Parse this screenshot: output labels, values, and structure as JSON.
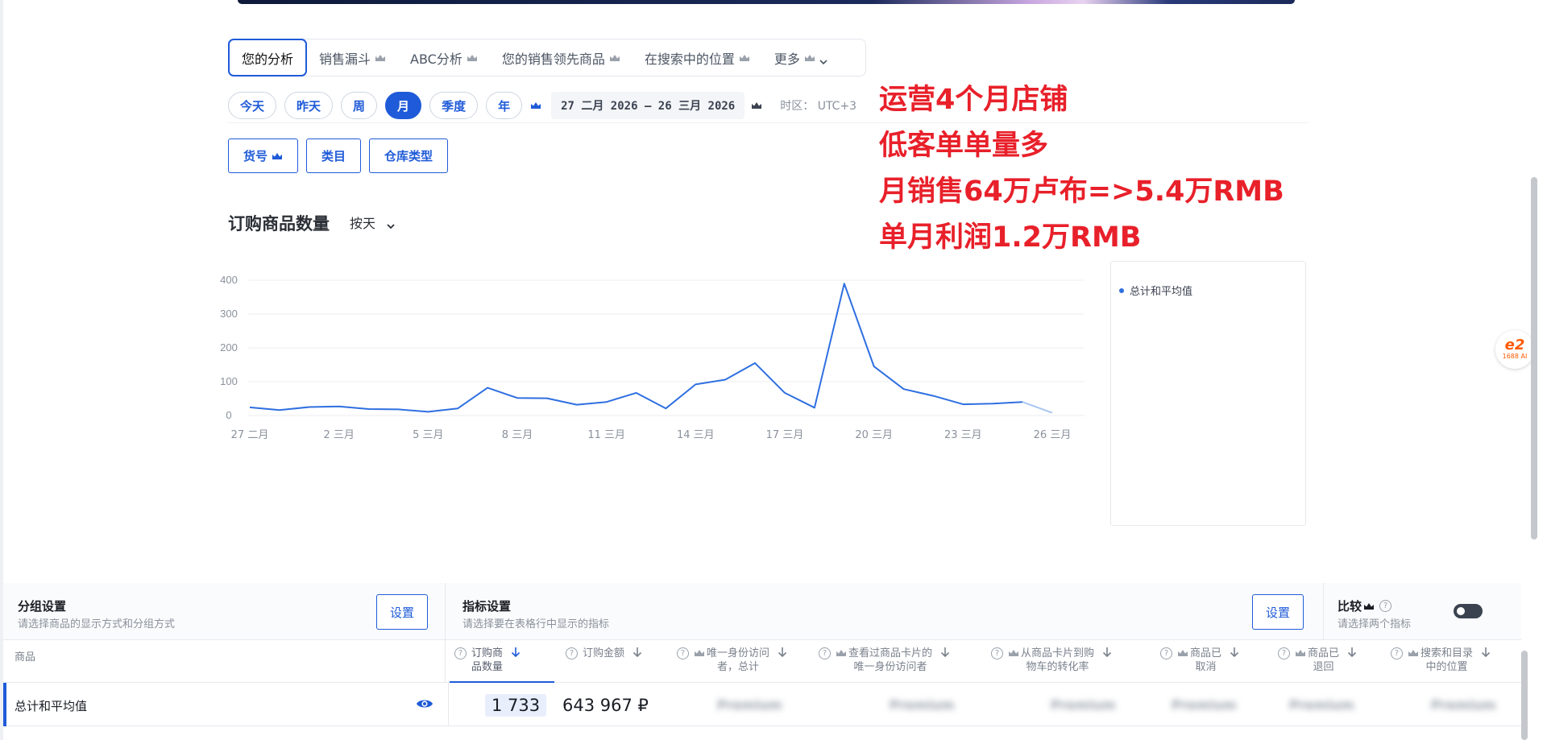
{
  "tabs": [
    {
      "label": "您的分析",
      "active": true,
      "crown": false,
      "chevron": false
    },
    {
      "label": "销售漏斗",
      "active": false,
      "crown": true,
      "chevron": false
    },
    {
      "label": "ABC分析",
      "active": false,
      "crown": true,
      "chevron": false
    },
    {
      "label": "您的销售领先商品",
      "active": false,
      "crown": true,
      "chevron": false
    },
    {
      "label": "在搜索中的位置",
      "active": false,
      "crown": true,
      "chevron": false
    },
    {
      "label": "更多",
      "active": false,
      "crown": true,
      "chevron": true
    }
  ],
  "periods": [
    {
      "label": "今天",
      "active": false
    },
    {
      "label": "昨天",
      "active": false
    },
    {
      "label": "周",
      "active": false
    },
    {
      "label": "月",
      "active": true
    },
    {
      "label": "季度",
      "active": false
    },
    {
      "label": "年",
      "active": false
    }
  ],
  "date_range": "27 二月 2026 – 26 三月 2026",
  "timezone": "时区： UTC+3",
  "filters": [
    {
      "label": "货号",
      "crown": true
    },
    {
      "label": "类目",
      "crown": false
    },
    {
      "label": "仓库类型",
      "crown": false
    }
  ],
  "chart_header": {
    "title": "订购商品数量",
    "granularity": "按天"
  },
  "overlay_text": [
    "运营4个月店铺",
    "低客单单量多",
    "月销售64万卢布=>5.4万RMB",
    "单月利润1.2万RMB"
  ],
  "overlay_color": "#e8202a",
  "accent_color": "#1f5bd8",
  "chart_data": {
    "type": "line",
    "title": "",
    "xlabel": "",
    "ylabel": "",
    "ylim": [
      0,
      400
    ],
    "yticks": [
      0,
      100,
      200,
      300,
      400
    ],
    "xtick_labels": [
      "27 二月",
      "2 三月",
      "5 三月",
      "8 三月",
      "11 三月",
      "14 三月",
      "17 三月",
      "20 三月",
      "23 三月",
      "26 三月"
    ],
    "xtick_positions": [
      0,
      3,
      6,
      9,
      12,
      15,
      18,
      21,
      24,
      27
    ],
    "grid": true,
    "legend_position": "right",
    "series": [
      {
        "name": "总计和平均值",
        "color": "#2f6fe0",
        "values": [
          24,
          16,
          25,
          27,
          19,
          18,
          11,
          21,
          82,
          52,
          51,
          32,
          40,
          67,
          21,
          92,
          106,
          155,
          67,
          23,
          390,
          145,
          78,
          58,
          33,
          35,
          40,
          8
        ],
        "partial_last_point": true
      }
    ]
  },
  "settings": {
    "group": {
      "title": "分组设置",
      "subtitle": "请选择商品的显示方式和分组方式",
      "button": "设置"
    },
    "metrics": {
      "title": "指标设置",
      "subtitle": "请选择要在表格行中显示的指标",
      "button": "设置"
    },
    "compare": {
      "title": "比较",
      "subtitle": "请选择两个指标",
      "toggle_on": false
    }
  },
  "table": {
    "product_header": "商品",
    "columns": [
      {
        "label": [
          "订购商",
          "品数量"
        ],
        "crown": false,
        "active": true
      },
      {
        "label": [
          "订购金额"
        ],
        "crown": false,
        "active": false
      },
      {
        "label": [
          "唯一身份访问",
          "者，总计"
        ],
        "crown": true,
        "active": false
      },
      {
        "label": [
          "查看过商品卡片的",
          "唯一身份访问者"
        ],
        "crown": true,
        "active": false
      },
      {
        "label": [
          "从商品卡片到购",
          "物车的转化率"
        ],
        "crown": true,
        "active": false
      },
      {
        "label": [
          "商品已",
          "取消"
        ],
        "crown": true,
        "active": false
      },
      {
        "label": [
          "商品已",
          "退回"
        ],
        "crown": true,
        "active": false
      },
      {
        "label": [
          "搜索和目录",
          "中的位置"
        ],
        "crown": true,
        "active": false
      }
    ],
    "row": {
      "name": "总计和平均值",
      "qty": "1 733",
      "amount": "643 967 ₽",
      "locked_placeholder": "Premium"
    }
  },
  "badge": {
    "logo": "e2",
    "sub": "1688 AI"
  }
}
